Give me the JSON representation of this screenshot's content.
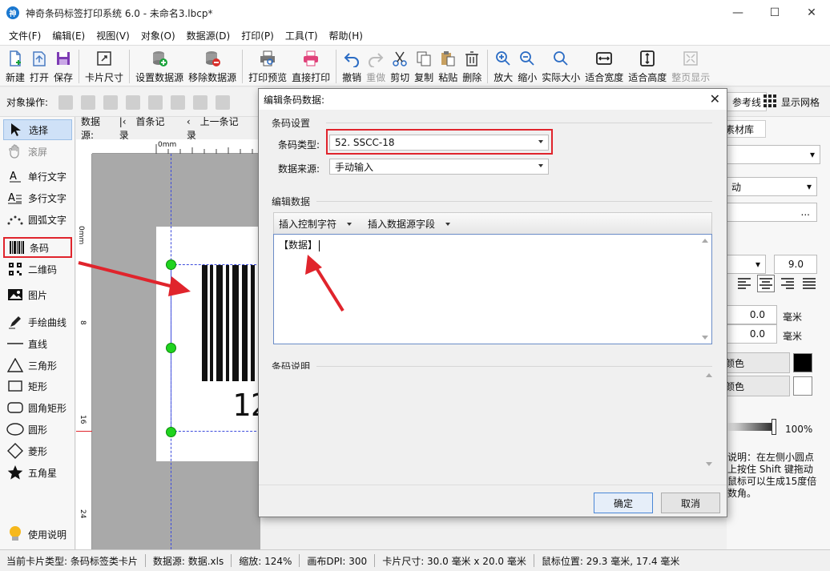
{
  "window": {
    "title": "神奇条码标签打印系统 6.0 - 未命名3.lbcp*",
    "app_icon_glyph": "神",
    "controls": {
      "minimize": "—",
      "maximize": "☐",
      "close": "✕"
    }
  },
  "menu": [
    "文件(F)",
    "编辑(E)",
    "视图(V)",
    "对象(O)",
    "数据源(D)",
    "打印(P)",
    "工具(T)",
    "帮助(H)"
  ],
  "toolbar": {
    "new": "新建",
    "open": "打开",
    "save": "保存",
    "card_size": "卡片尺寸",
    "set_datasource": "设置数据源",
    "remove_datasource": "移除数据源",
    "print_preview": "打印预览",
    "direct_print": "直接打印",
    "undo": "撤销",
    "redo": "重做",
    "cut": "剪切",
    "copy": "复制",
    "paste": "粘贴",
    "delete": "删除",
    "zoom_in": "放大",
    "zoom_out": "缩小",
    "actual_size": "实际大小",
    "fit_width": "适合宽度",
    "fit_height": "适合高度",
    "full_page": "整页显示"
  },
  "objbar": {
    "label": "对象操作:",
    "ref_line": "参考线",
    "show_grid": "显示网格"
  },
  "tools": {
    "select": "选择",
    "scroll": "滚屏",
    "single_text": "单行文字",
    "multi_text": "多行文字",
    "arc_text": "圆弧文字",
    "barcode": "条码",
    "qrcode": "二维码",
    "image": "图片",
    "freehand": "手绘曲线",
    "line": "直线",
    "triangle": "三角形",
    "rectangle": "矩形",
    "round_rect": "圆角矩形",
    "circle": "圆形",
    "diamond": "菱形",
    "star": "五角星",
    "help": "使用说明"
  },
  "canvas": {
    "datasource_label": "数据源:",
    "first_record": "首条记录",
    "prev_record": "上一条记录",
    "ruler_top_zero": "0mm",
    "ruler_left": [
      "0mm",
      "8",
      "16",
      "24"
    ],
    "barcode_text": "12"
  },
  "right_panel": {
    "tab_material": "素材库",
    "dropdown_partial": "动",
    "ellipsis": "...",
    "font_size": "9.0",
    "offset_x": "0.0",
    "offset_y": "0.0",
    "unit": "毫米",
    "fg_color_label": "颜色",
    "bg_color_label": "颜色",
    "fg_color": "#000000",
    "bg_color": "#ffffff",
    "opacity": "100%",
    "help_text": "说明：在左侧小圆点上按住 Shift 键拖动鼠标可以生成15度倍数角。"
  },
  "dialog": {
    "title": "编辑条码数据:",
    "section_settings": "条码设置",
    "barcode_type_label": "条码类型:",
    "barcode_type_value": "52.  SSCC-18",
    "data_source_label": "数据来源:",
    "data_source_value": "手动输入",
    "section_edit": "编辑数据",
    "insert_control_char": "插入控制字符",
    "insert_datasource_field": "插入数据源字段",
    "editor_text": "【数据】",
    "section_desc": "条码说明",
    "ok": "确定",
    "cancel": "取消"
  },
  "status": {
    "card_type": "当前卡片类型: 条码标签类卡片",
    "datasource": "数据源: 数据.xls",
    "zoom": "缩放: 124%",
    "dpi": "画布DPI: 300",
    "card_size": "卡片尺寸: 30.0 毫米 x 20.0 毫米",
    "mouse_pos": "鼠标位置: 29.3 毫米, 17.4 毫米"
  },
  "colors": {
    "accent": "#1b78d0",
    "highlight": "#e0242c",
    "handle": "#1fd31f",
    "selection": "#3c4bdc"
  }
}
